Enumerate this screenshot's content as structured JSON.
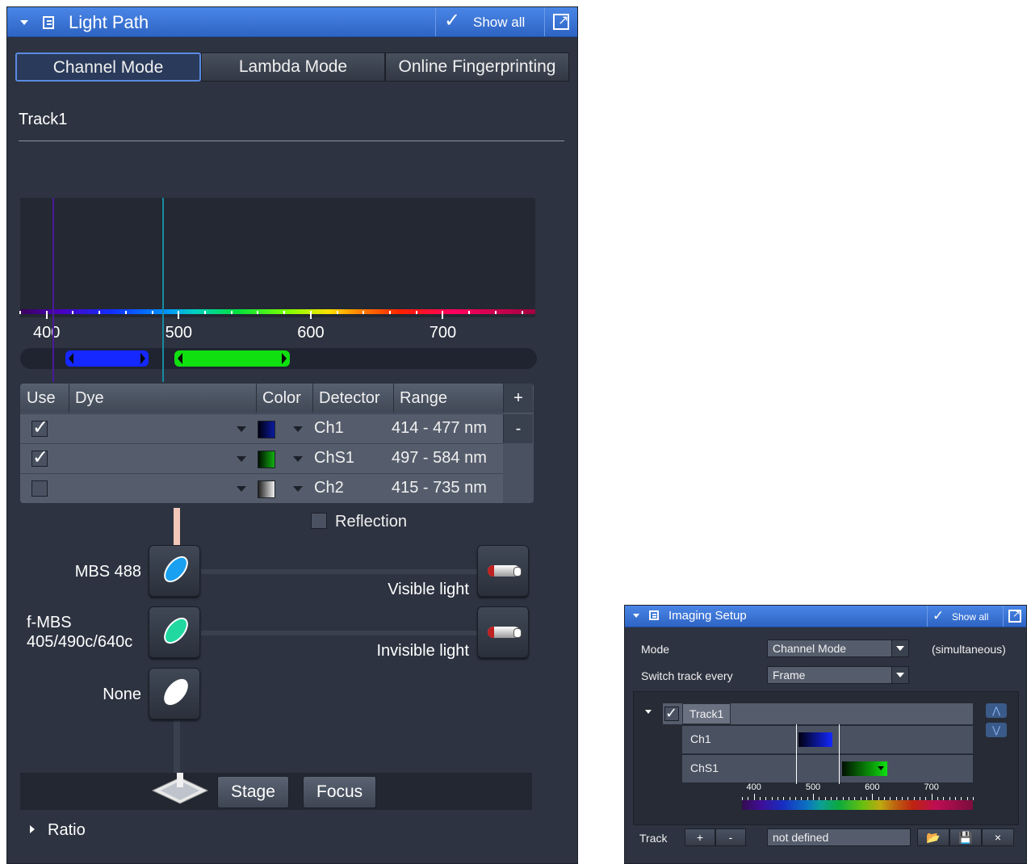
{
  "light_path": {
    "title": "Light Path",
    "show_all": "Show all",
    "mode_tabs": [
      "Channel Mode",
      "Lambda Mode",
      "Online Fingerprinting"
    ],
    "active_tab": "Channel Mode",
    "track_title": "Track1",
    "spectrum": {
      "axis_min": 380,
      "axis_max": 770,
      "tick_labels": [
        "400",
        "500",
        "600",
        "700"
      ],
      "laser_lines_nm": [
        405,
        488
      ],
      "ranges": [
        {
          "channel": "Ch1",
          "from": 414,
          "to": 477,
          "color": "#1428ff"
        },
        {
          "channel": "ChS1",
          "from": 497,
          "to": 584,
          "color": "#10e010"
        }
      ]
    },
    "channel_table": {
      "headers": [
        "Use",
        "Dye",
        "Color",
        "Detector",
        "Range"
      ],
      "add_label": "+",
      "remove_label": "-",
      "rows": [
        {
          "use": true,
          "dye": "",
          "color": "#0a1aa0",
          "detector": "Ch1",
          "range": "414 - 477 nm"
        },
        {
          "use": true,
          "dye": "",
          "color": "#10b010",
          "detector": "ChS1",
          "range": "497 - 584 nm"
        },
        {
          "use": false,
          "dye": "",
          "color": "#e0e0e0",
          "detector": "Ch2",
          "range": "415 - 735 nm"
        }
      ]
    },
    "reflection_label": "Reflection",
    "mirrors": [
      {
        "label": "MBS 488",
        "color": "#1aa0f0"
      },
      {
        "label": "f-MBS\n405/490c/640c",
        "color": "#20d8a0"
      },
      {
        "label": "None",
        "color": "#ffffff"
      }
    ],
    "visible_light_label": "Visible light",
    "invisible_light_label": "Invisible light",
    "stage_label": "Stage",
    "focus_label": "Focus",
    "ratio_label": "Ratio"
  },
  "imaging_setup": {
    "title": "Imaging Setup",
    "show_all": "Show all",
    "mode_label": "Mode",
    "mode_value": "Channel Mode",
    "mode_note": "(simultaneous)",
    "switch_label": "Switch track every",
    "switch_value": "Frame",
    "track_name": "Track1",
    "channels": [
      "Ch1",
      "ChS1"
    ],
    "tick_labels": [
      "400",
      "500",
      "600",
      "700"
    ],
    "track_label": "Track",
    "add_label": "+",
    "remove_label": "-",
    "config_value": "not defined",
    "close_label": "×"
  },
  "colors": {
    "panel_bg": "#2d3340",
    "titlebar": "#3a75d8",
    "ch1": "#1428ff",
    "chs1": "#10e010"
  }
}
